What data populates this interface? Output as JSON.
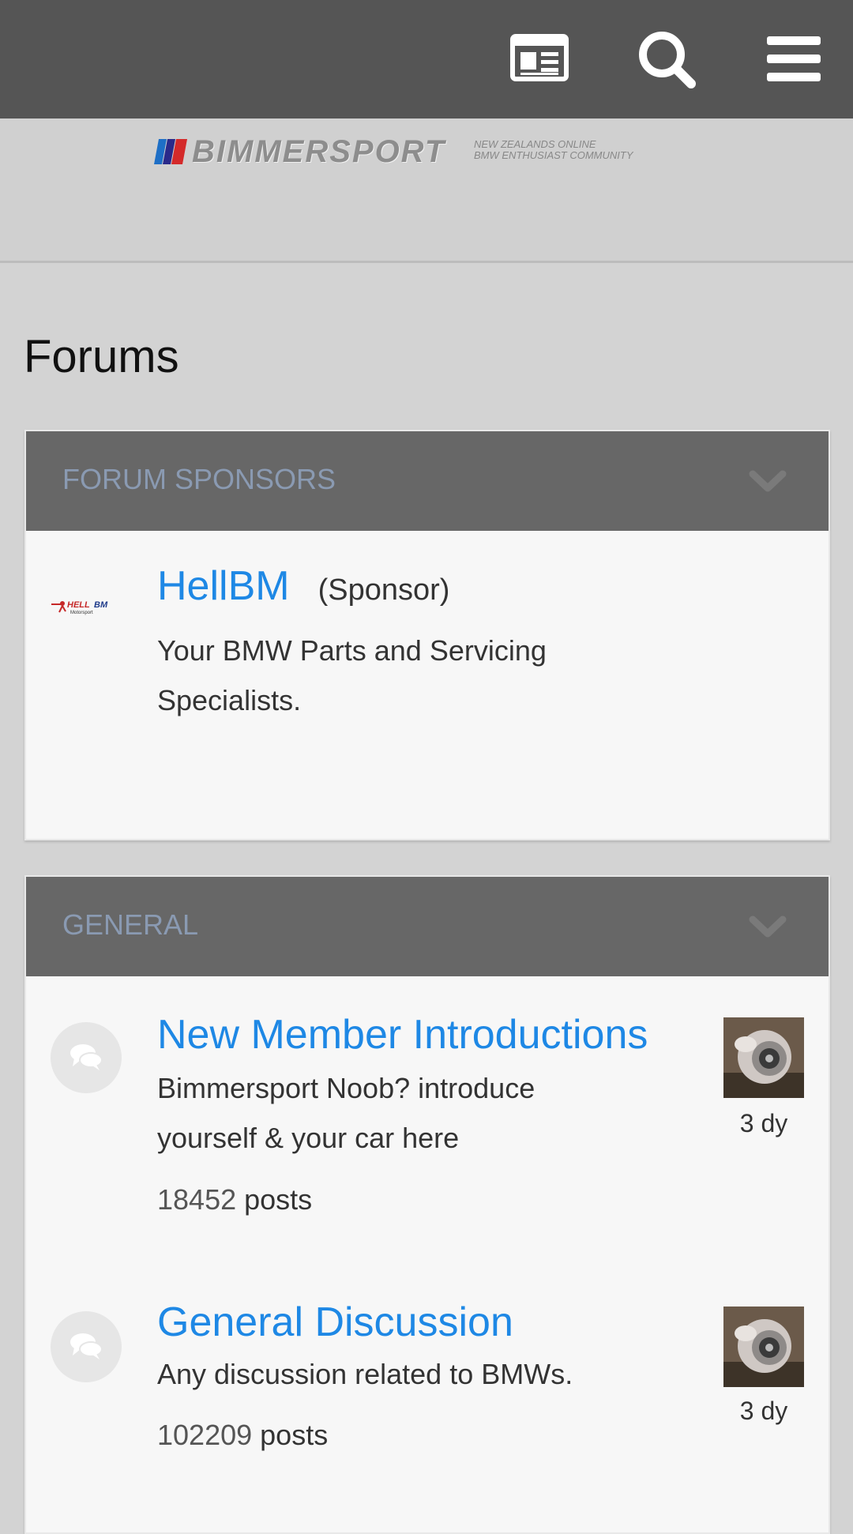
{
  "header": {
    "news_icon": "newspaper-icon",
    "search_icon": "search-icon",
    "menu_icon": "hamburger-menu-icon"
  },
  "logo": {
    "brand": "BIMMERSPORT",
    "tagline_line1": "NEW ZEALANDS ONLINE",
    "tagline_line2": "BMW ENTHUSIAST COMMUNITY"
  },
  "page": {
    "title": "Forums"
  },
  "categories": [
    {
      "title": "FORUM SPONSORS",
      "forums": [
        {
          "title": "HellBM",
          "tag": "(Sponsor)",
          "description": "Your BMW Parts and Servicing Specialists.",
          "logo_text": "HELL",
          "logo_text2": "BM",
          "logo_sub": "Motorsport"
        }
      ]
    },
    {
      "title": "GENERAL",
      "forums": [
        {
          "title": "New Member Introductions",
          "description": "Bimmersport Noob? introduce yourself & your car here",
          "post_count": "18452",
          "posts_label": "posts",
          "last_post_time": "3 dy"
        },
        {
          "title": "General Discussion",
          "description": "Any discussion related to BMWs.",
          "post_count": "102209",
          "posts_label": "posts",
          "last_post_time": "3 dy"
        }
      ]
    }
  ],
  "colors": {
    "topbar": "#555555",
    "category_header": "#676767",
    "link": "#1e88e5",
    "category_title": "#8a9ab2"
  }
}
